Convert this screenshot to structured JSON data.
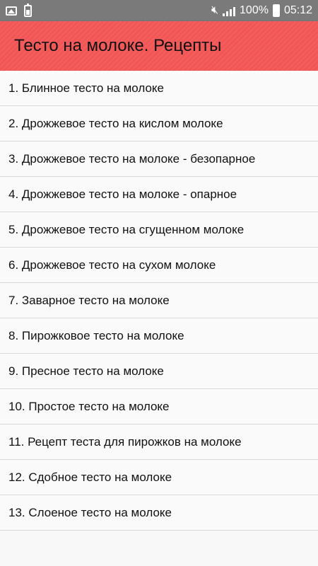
{
  "statusbar": {
    "battery_percent": "100%",
    "time": "05:12",
    "icons": [
      "image-notification-icon",
      "battery-notification-icon",
      "mute-icon",
      "signal-icon",
      "battery-icon"
    ]
  },
  "toolbar": {
    "title": "Тесто на молоке. Рецепты",
    "color": "#f25555"
  },
  "recipes": [
    "1. Блинное тесто на молоке",
    "2. Дрожжевое тесто на кислом молоке",
    "3. Дрожжевое тесто на молоке - безопарное",
    "4. Дрожжевое тесто на молоке - опарное",
    "5. Дрожжевое тесто на сгущенном молоке",
    "6. Дрожжевое тесто на сухом молоке",
    "7. Заварное тесто на молоке",
    "8. Пирожковое тесто на молоке",
    "9. Пресное тесто на молоке",
    "10. Простое тесто на молоке",
    "11. Рецепт теста для пирожков на молоке",
    "12. Сдобное тесто на молоке",
    "13. Слоеное тесто на молоке"
  ]
}
